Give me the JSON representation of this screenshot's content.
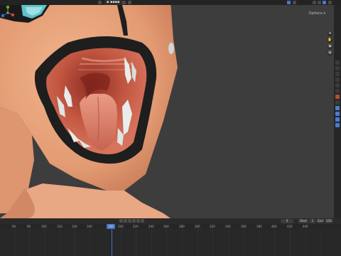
{
  "topbar": {
    "mode_label": "▪ ▪▪▪▪"
  },
  "viewport": {
    "options_label": "Options ▾",
    "gizmo": {
      "x": "X",
      "y": "Y",
      "z": "Z"
    }
  },
  "timeline": {
    "current_frame": "120",
    "start_label": "Start",
    "start_value": "1",
    "end_label": "End",
    "end_value": "250",
    "frame_current_field": "0",
    "ticks": [
      "60",
      "80",
      "100",
      "120",
      "140",
      "160",
      "180",
      "200",
      "220",
      "240",
      "260",
      "280",
      "300",
      "320",
      "340",
      "360",
      "380",
      "400",
      "420",
      "440"
    ]
  },
  "colors": {
    "accent": "#4472c4",
    "skin": "#e7a67d",
    "lips": "#1f1f1f",
    "mouth_inside": "#b84a38",
    "tongue": "#d9816f"
  }
}
